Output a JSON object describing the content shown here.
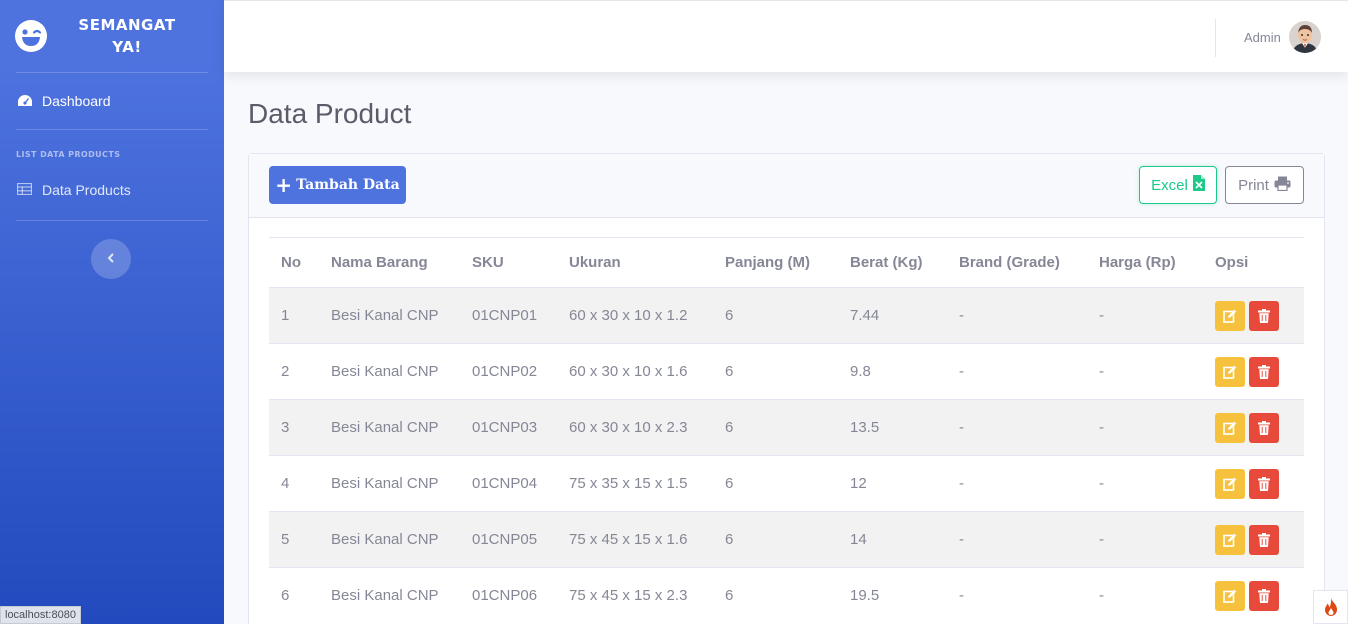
{
  "app": {
    "brand_line1": "SEMANGAT",
    "brand_line2": "YA!",
    "accent": "#4e73df"
  },
  "sidebar": {
    "items": [
      {
        "label": "Dashboard",
        "icon": "tachometer-icon"
      },
      {
        "label": "Data Products",
        "icon": "table-icon"
      }
    ],
    "section_heading": "LIST DATA PRODUCTS",
    "toggle_icon": "chevron-left-icon"
  },
  "topbar": {
    "user_name": "Admin",
    "avatar_icon": "user-avatar"
  },
  "page": {
    "title": "Data Product"
  },
  "toolbar": {
    "add_label": "Tambah Data",
    "excel_label": "Excel",
    "print_label": "Print"
  },
  "table": {
    "headers": [
      "No",
      "Nama Barang",
      "SKU",
      "Ukuran",
      "Panjang (M)",
      "Berat (Kg)",
      "Brand (Grade)",
      "Harga (Rp)",
      "Opsi"
    ],
    "rows": [
      [
        "1",
        "Besi Kanal CNP",
        "01CNP01",
        "60 x 30 x 10 x 1.2",
        "6",
        "7.44",
        "-",
        "-"
      ],
      [
        "2",
        "Besi Kanal CNP",
        "01CNP02",
        "60 x 30 x 10 x 1.6",
        "6",
        "9.8",
        "-",
        "-"
      ],
      [
        "3",
        "Besi Kanal CNP",
        "01CNP03",
        "60 x 30 x 10 x 2.3",
        "6",
        "13.5",
        "-",
        "-"
      ],
      [
        "4",
        "Besi Kanal CNP",
        "01CNP04",
        "75 x 35 x 15 x 1.5",
        "6",
        "12",
        "-",
        "-"
      ],
      [
        "5",
        "Besi Kanal CNP",
        "01CNP05",
        "75 x 45 x 15 x 1.6",
        "6",
        "14",
        "-",
        "-"
      ],
      [
        "6",
        "Besi Kanal CNP",
        "01CNP06",
        "75 x 45 x 15 x 2.3",
        "6",
        "19.5",
        "-",
        "-"
      ]
    ]
  },
  "status_bar": {
    "url": "localhost:8080"
  }
}
